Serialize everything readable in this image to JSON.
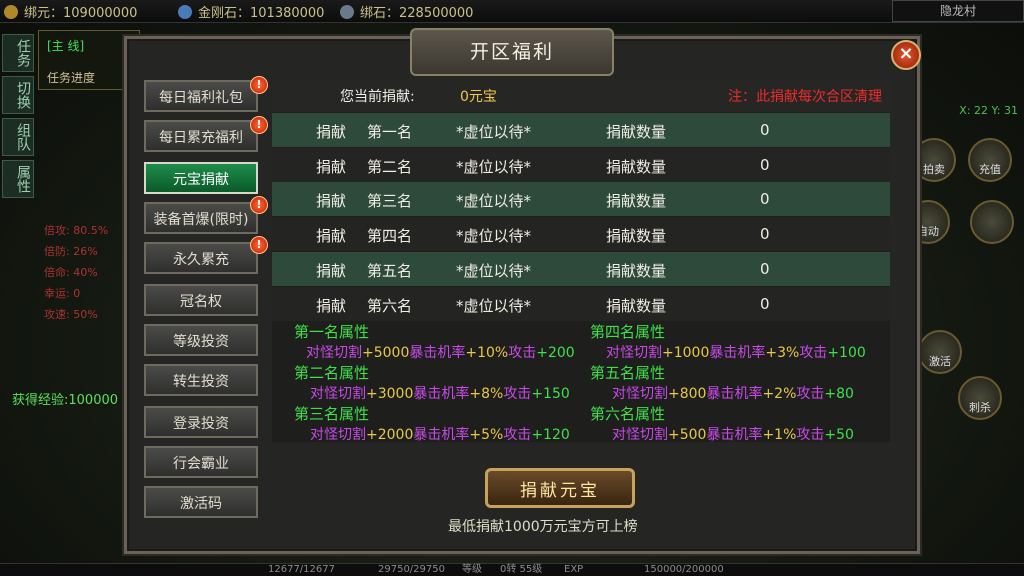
{
  "resources": [
    {
      "label": "绑元：",
      "value": "109000000",
      "icon": "coin-icon",
      "color": "#b08a2a"
    },
    {
      "label": "金刚石：",
      "value": "101380000",
      "icon": "diamond-icon",
      "color": "#4a7ab8"
    },
    {
      "label": "绑石：",
      "value": "228500000",
      "icon": "stone-icon",
      "color": "#6a7a8a"
    }
  ],
  "location": "隐龙村",
  "coords": "X: 22  Y: 31",
  "side_tabs": [
    "任务",
    "切换",
    "组队",
    "属性"
  ],
  "task": {
    "line1": "[主 线]",
    "line2": "任务进度"
  },
  "stats": [
    "倍攻: 80.5%",
    "倍防: 26%",
    "倍命: 40%",
    "幸运: 0",
    "攻速: 50%"
  ],
  "exp_text": "获得经验:100000",
  "right_hud": [
    "拍卖",
    "充值",
    "自动",
    "",
    "激活",
    "刺杀"
  ],
  "bottom": {
    "hp": "12677/12677",
    "mp": "29750/29750",
    "level": "等级",
    "rebirth": "0转 55级",
    "exp": "EXP",
    "exp_val": "150000/200000"
  },
  "dialog": {
    "title": "开区福利",
    "close": "×",
    "menu": [
      {
        "label": "每日福利礼包",
        "badge": "!"
      },
      {
        "label": "每日累充福利",
        "badge": "!"
      },
      {
        "label": "元宝捐献",
        "badge": "",
        "active": true
      },
      {
        "label": "装备首爆(限时)",
        "badge": "!"
      },
      {
        "label": "永久累充",
        "badge": "!"
      },
      {
        "label": "冠名权",
        "badge": ""
      },
      {
        "label": "等级投资",
        "badge": ""
      },
      {
        "label": "转生投资",
        "badge": ""
      },
      {
        "label": "登录投资",
        "badge": ""
      },
      {
        "label": "行会霸业",
        "badge": ""
      },
      {
        "label": "激活码",
        "badge": ""
      }
    ],
    "current_label": "您当前捐献:",
    "current_value": "0元宝",
    "note": "注：此捐献每次合区清理",
    "ranks": [
      {
        "c1": "捐献",
        "c2": "第一名",
        "c3": "*虚位以待*",
        "c4": "捐献数量",
        "c5": "0"
      },
      {
        "c1": "捐献",
        "c2": "第二名",
        "c3": "*虚位以待*",
        "c4": "捐献数量",
        "c5": "0"
      },
      {
        "c1": "捐献",
        "c2": "第三名",
        "c3": "*虚位以待*",
        "c4": "捐献数量",
        "c5": "0"
      },
      {
        "c1": "捐献",
        "c2": "第四名",
        "c3": "*虚位以待*",
        "c4": "捐献数量",
        "c5": "0"
      },
      {
        "c1": "捐献",
        "c2": "第五名",
        "c3": "*虚位以待*",
        "c4": "捐献数量",
        "c5": "0"
      },
      {
        "c1": "捐献",
        "c2": "第六名",
        "c3": "*虚位以待*",
        "c4": "捐献数量",
        "c5": "0"
      }
    ],
    "attrs": [
      {
        "title": "第一名属性",
        "p1": "对怪切割",
        "v1": "+5000",
        "p2": "暴击机率",
        "v2": "+10%",
        "p3": "攻击",
        "v3": "+200"
      },
      {
        "title": "第二名属性",
        "p1": "对怪切割",
        "v1": "+3000",
        "p2": "暴击机率",
        "v2": "+8%",
        "p3": "攻击",
        "v3": "+150"
      },
      {
        "title": "第三名属性",
        "p1": "对怪切割",
        "v1": "+2000",
        "p2": "暴击机率",
        "v2": "+5%",
        "p3": "攻击",
        "v3": "+120"
      },
      {
        "title": "第四名属性",
        "p1": "对怪切割",
        "v1": "+1000",
        "p2": "暴击机率",
        "v2": "+3%",
        "p3": "攻击",
        "v3": "+100"
      },
      {
        "title": "第五名属性",
        "p1": "对怪切割",
        "v1": "+800",
        "p2": "暴击机率",
        "v2": "+2%",
        "p3": "攻击",
        "v3": "+80"
      },
      {
        "title": "第六名属性",
        "p1": "对怪切割",
        "v1": "+500",
        "p2": "暴击机率",
        "v2": "+1%",
        "p3": "攻击",
        "v3": "+50"
      }
    ],
    "donate_button": "捐献元宝",
    "hint": "最低捐献1000万元宝方可上榜"
  }
}
